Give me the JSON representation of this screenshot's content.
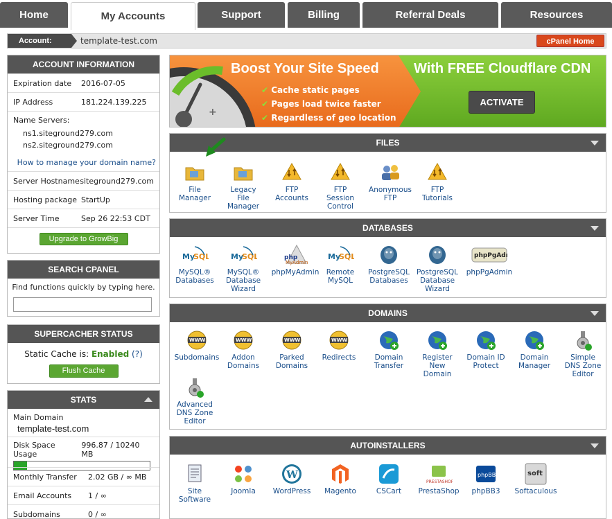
{
  "nav": {
    "tabs": [
      "Home",
      "My Accounts",
      "Support",
      "Billing",
      "Referral Deals",
      "Resources"
    ],
    "active": "My Accounts"
  },
  "account_bar": {
    "label": "Account:",
    "domain": "template-test.com",
    "cpanel_button": "cPanel Home"
  },
  "account_info": {
    "title": "ACCOUNT INFORMATION",
    "expiration_label": "Expiration date",
    "expiration_value": "2016-07-05",
    "ip_label": "IP Address",
    "ip_value": "181.224.139.225",
    "ns_label": "Name Servers:",
    "ns1": "ns1.siteground279.com",
    "ns2": "ns2.siteground279.com",
    "ns_link": "How to manage your domain name?",
    "hostname_label": "Server Hostname",
    "hostname_value": "siteground279.com",
    "package_label": "Hosting package",
    "package_value": "StartUp",
    "time_label": "Server Time",
    "time_value": "Sep 26 22:53 CDT",
    "upgrade_button": "Upgrade to GrowBig"
  },
  "search": {
    "title": "SEARCH CPANEL",
    "hint": "Find functions quickly by typing here.",
    "value": "",
    "placeholder": ""
  },
  "supercacher": {
    "title": "SUPERCACHER STATUS",
    "label": "Static Cache is:",
    "status": "Enabled",
    "help": "(?)",
    "flush_button": "Flush Cache"
  },
  "stats": {
    "title": "STATS",
    "main_domain_label": "Main Domain",
    "main_domain_value": "template-test.com",
    "disk_label": "Disk Space Usage",
    "disk_value": "996.87 / 10240 MB",
    "disk_fraction": 0.097,
    "transfer_label": "Monthly Transfer",
    "transfer_value": "2.02 GB / ∞ MB",
    "email_label": "Email Accounts",
    "email_value": "1 / ∞",
    "subdomains_label": "Subdomains",
    "subdomains_value": "0 / ∞"
  },
  "banner": {
    "headline": "Boost Your Site Speed",
    "bullet1": "Cache static pages",
    "bullet2": "Pages load twice faster",
    "bullet3": "Regardless of geo location",
    "cdn_title": "With FREE Cloudflare CDN",
    "activate": "ACTIVATE"
  },
  "files": {
    "title": "FILES",
    "items": [
      "File\nManager",
      "Legacy\nFile\nManager",
      "FTP\nAccounts",
      "FTP\nSession\nControl",
      "Anonymous\nFTP",
      "FTP\nTutorials"
    ]
  },
  "databases": {
    "title": "DATABASES",
    "items": [
      "MySQL®\nDatabases",
      "MySQL®\nDatabase\nWizard",
      "phpMyAdmin",
      "Remote\nMySQL",
      "PostgreSQL\nDatabases",
      "PostgreSQL\nDatabase\nWizard",
      "phpPgAdmin"
    ]
  },
  "domains": {
    "title": "DOMAINS",
    "items": [
      "Subdomains",
      "Addon\nDomains",
      "Parked\nDomains",
      "Redirects",
      "Domain\nTransfer",
      "Register\nNew\nDomain",
      "Domain ID\nProtect",
      "Domain\nManager",
      "Simple\nDNS Zone\nEditor",
      "Advanced\nDNS Zone\nEditor"
    ]
  },
  "autoinstallers": {
    "title": "AUTOINSTALLERS",
    "items": [
      "Site\nSoftware",
      "Joomla",
      "WordPress",
      "Magento",
      "CSCart",
      "PrestaShop",
      "phpBB3",
      "Softaculous"
    ]
  },
  "colors": {
    "header": "#555555",
    "accent_green": "#5ba632",
    "orange": "#f07a2a",
    "link": "#1a4e8a"
  }
}
